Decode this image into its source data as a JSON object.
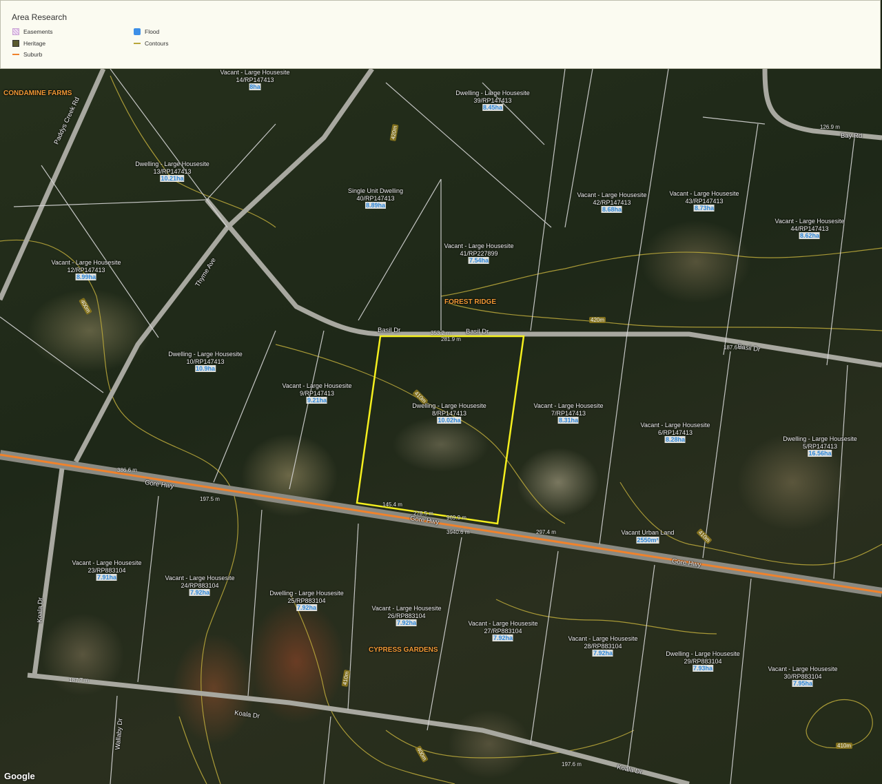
{
  "panel": {
    "title": "Area Research",
    "legend": [
      {
        "label": "Easements",
        "icon": "easements-swatch"
      },
      {
        "label": "Heritage",
        "icon": "heritage-swatch"
      },
      {
        "label": "Suburb",
        "icon": "suburb-line"
      },
      {
        "label": "Flood",
        "icon": "flood-swatch"
      },
      {
        "label": "Contours",
        "icon": "contours-line"
      }
    ]
  },
  "map": {
    "suburbs": [
      "CONDAMINE FARMS",
      "FOREST RIDGE",
      "CYPRESS GARDENS"
    ],
    "roads": [
      "Paddys Creek Rd",
      "Thyme Ave",
      "Basil Dr",
      "Bay Rd",
      "Gore Hwy",
      "Koala Dr",
      "Wallaby Dr"
    ],
    "parcels": [
      {
        "type": "Vacant - Large Housesite",
        "lot": "14/RP147413",
        "area": "8ha"
      },
      {
        "type": "Dwelling - Large Housesite",
        "lot": "39/RP147413",
        "area": "8.45ha"
      },
      {
        "type": "Dwelling - Large Housesite",
        "lot": "13/RP147413",
        "area": "10.21ha"
      },
      {
        "type": "Single Unit Dwelling",
        "lot": "40/RP147413",
        "area": "8.89ha"
      },
      {
        "type": "Vacant - Large Housesite",
        "lot": "42/RP147413",
        "area": "8.68ha"
      },
      {
        "type": "Vacant - Large Housesite",
        "lot": "43/RP147413",
        "area": "8.73ha"
      },
      {
        "type": "Vacant - Large Housesite",
        "lot": "44/RP147413",
        "area": "8.62ha"
      },
      {
        "type": "Vacant - Large Housesite",
        "lot": "12/RP147413",
        "area": "8.99ha"
      },
      {
        "type": "Vacant - Large Housesite",
        "lot": "41/RP227899",
        "area": "7.54ha"
      },
      {
        "type": "Dwelling - Large Housesite",
        "lot": "10/RP147413",
        "area": "10.9ha"
      },
      {
        "type": "Vacant - Large Housesite",
        "lot": "9/RP147413",
        "area": "9.21ha"
      },
      {
        "type": "Dwelling - Large Housesite",
        "lot": "8/RP147413",
        "area": "10.02ha"
      },
      {
        "type": "Vacant - Large Housesite",
        "lot": "7/RP147413",
        "area": "8.31ha"
      },
      {
        "type": "Vacant - Large Housesite",
        "lot": "6/RP147413",
        "area": "8.28ha"
      },
      {
        "type": "Dwelling - Large Housesite",
        "lot": "5/RP147413",
        "area": "16.56ha"
      },
      {
        "type": "Vacant Urban Land",
        "lot": "",
        "area": "2550m²"
      },
      {
        "type": "Vacant - Large Housesite",
        "lot": "23/RP883104",
        "area": "7.91ha"
      },
      {
        "type": "Vacant - Large Housesite",
        "lot": "24/RP883104",
        "area": "7.92ha"
      },
      {
        "type": "Dwelling - Large Housesite",
        "lot": "25/RP883104",
        "area": "7.92ha"
      },
      {
        "type": "Vacant - Large Housesite",
        "lot": "26/RP883104",
        "area": "7.92ha"
      },
      {
        "type": "Vacant - Large Housesite",
        "lot": "27/RP883104",
        "area": "7.92ha"
      },
      {
        "type": "Vacant - Large Housesite",
        "lot": "28/RP883104",
        "area": "7.92ha"
      },
      {
        "type": "Dwelling - Large Housesite",
        "lot": "29/RP883104",
        "area": "7.93ha"
      },
      {
        "type": "Vacant - Large Housesite",
        "lot": "30/RP883104",
        "area": "7.95ha"
      }
    ],
    "dimensions": [
      "353.2 m",
      "281.9 m",
      "145.4 m",
      "278.5 m",
      "969.9 m",
      "3940.6 m",
      "297.4 m",
      "386.6 m",
      "197.5 m",
      "187.7 m",
      "187.6 m",
      "126.9 m",
      "197.6 m"
    ],
    "contours": [
      "420m",
      "410m",
      "400m"
    ],
    "attribution": "Google"
  }
}
